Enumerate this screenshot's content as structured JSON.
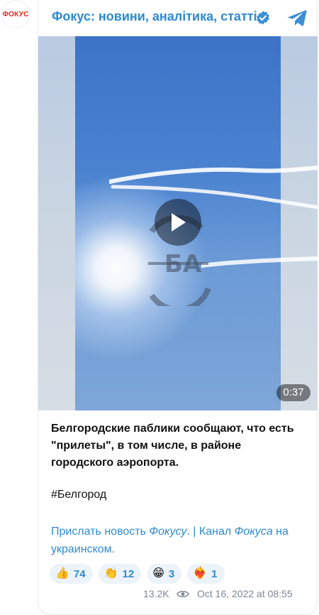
{
  "avatar": {
    "text": "ФОКУС"
  },
  "channel": {
    "title": "Фокус: новини, аналітика, статті"
  },
  "media": {
    "duration": "0:37"
  },
  "post": {
    "text": "Белгородские паблики сообщают, что есть \"прилеты\", в том числе, в районе городского аэропорта.",
    "hashtag": "#Белгород",
    "link1_text": "Прислать новость ",
    "link1_italic": "Фокусу",
    "separator": ". | ",
    "link2_text": "Канал",
    "link2_italic": "Фокуса",
    "link2_rest": " на украинском",
    "link_end": "."
  },
  "reactions": [
    {
      "emoji": "👍",
      "count": "74"
    },
    {
      "emoji": "👏",
      "count": "12"
    },
    {
      "emoji": "😁",
      "count": "3"
    },
    {
      "emoji": "❤️‍🔥",
      "count": "1"
    }
  ],
  "footer": {
    "views": "13.2K",
    "date": "Oct 16, 2022 at 08:55"
  },
  "colors": {
    "accent": "#2e8ad1",
    "brand": "#e2241c"
  }
}
